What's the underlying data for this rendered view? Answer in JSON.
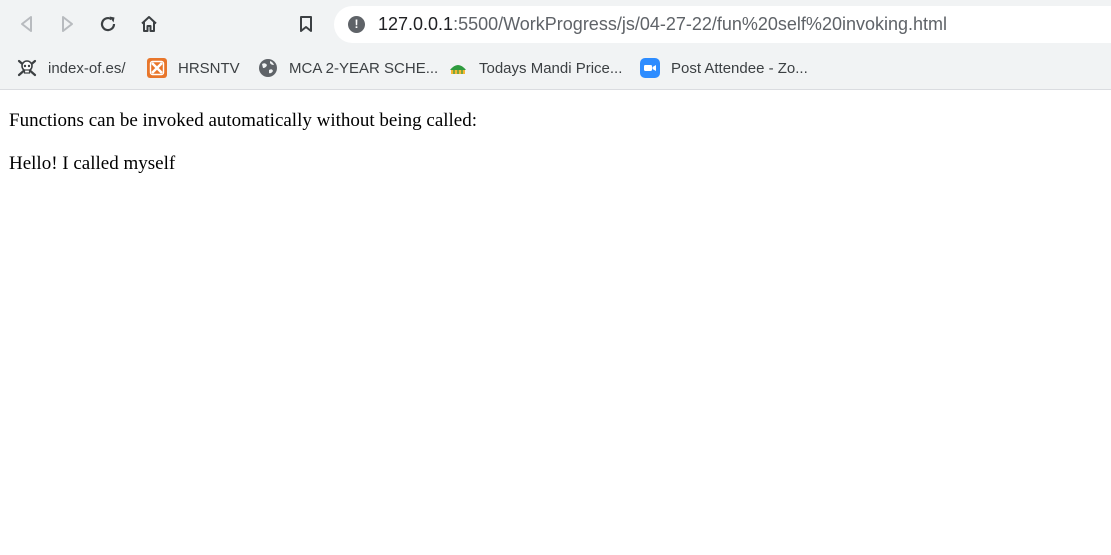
{
  "toolbar": {
    "back_icon": "back-arrow-icon",
    "forward_icon": "forward-arrow-icon",
    "reload_icon": "reload-icon",
    "home_icon": "home-icon",
    "bookmark_icon": "bookmark-icon",
    "url_host": "127.0.0.1",
    "url_path": ":5500/WorkProgress/js/04-27-22/fun%20self%20invoking.html"
  },
  "bookmarks": [
    {
      "label": "index-of.es/",
      "icon": "skull-icon"
    },
    {
      "label": "HRSNTV",
      "icon": "hrsntv-logo-icon"
    },
    {
      "label": "MCA 2-YEAR SCHE...",
      "icon": "globe-icon"
    },
    {
      "label": "Todays Mandi Price...",
      "icon": "mandi-logo-icon"
    },
    {
      "label": "Post Attendee - Zo...",
      "icon": "zoom-icon"
    }
  ],
  "page": {
    "line1": "Functions can be invoked automatically without being called:",
    "line2": "Hello! I called myself"
  },
  "colors": {
    "toolbar_bg": "#f1f3f4",
    "hrsntv_orange": "#e8762b",
    "zoom_blue": "#2d8cff",
    "mandi_green": "#2e9b3e"
  }
}
